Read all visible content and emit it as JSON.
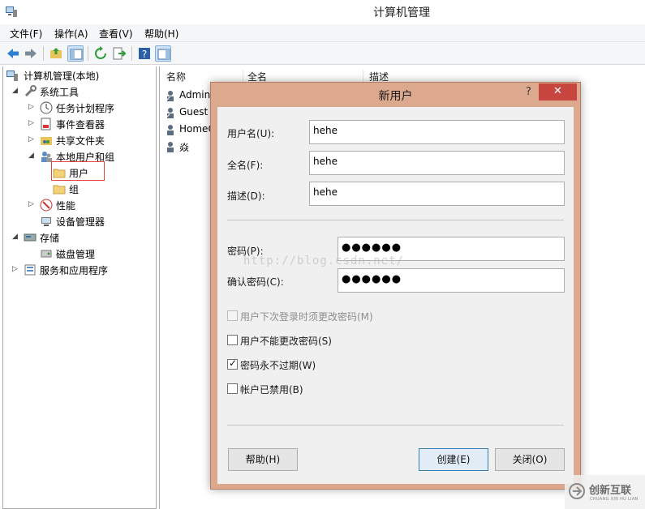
{
  "window": {
    "title": "计算机管理"
  },
  "menu": [
    "文件(F)",
    "操作(A)",
    "查看(V)",
    "帮助(H)"
  ],
  "tree": [
    {
      "label": "计算机管理(本地)",
      "icon": "computer-management-icon",
      "arrow": ""
    },
    {
      "label": "系统工具",
      "icon": "tools-icon",
      "arrow": "◢"
    },
    {
      "label": "任务计划程序",
      "icon": "clock-icon",
      "arrow": "▷"
    },
    {
      "label": "事件查看器",
      "icon": "event-viewer-icon",
      "arrow": "▷"
    },
    {
      "label": "共享文件夹",
      "icon": "shared-folder-icon",
      "arrow": "▷"
    },
    {
      "label": "本地用户和组",
      "icon": "users-groups-icon",
      "arrow": "◢"
    },
    {
      "label": "用户",
      "icon": "folder-icon",
      "arrow": ""
    },
    {
      "label": "组",
      "icon": "folder-icon",
      "arrow": ""
    },
    {
      "label": "性能",
      "icon": "performance-icon",
      "arrow": "▷"
    },
    {
      "label": "设备管理器",
      "icon": "device-manager-icon",
      "arrow": ""
    },
    {
      "label": "存储",
      "icon": "storage-icon",
      "arrow": "◢"
    },
    {
      "label": "磁盘管理",
      "icon": "disk-icon",
      "arrow": ""
    },
    {
      "label": "服务和应用程序",
      "icon": "services-icon",
      "arrow": "▷"
    }
  ],
  "list": {
    "columns": [
      "名称",
      "全名",
      "描述"
    ],
    "rows": [
      "Admini",
      "Guest",
      "HomeG",
      "焱"
    ]
  },
  "dialog": {
    "title": "新用户",
    "help_glyph": "?",
    "close_glyph": "✕",
    "username_label": "用户名(U):",
    "username_value": "hehe",
    "fullname_label": "全名(F):",
    "fullname_value": "hehe",
    "description_label": "描述(D):",
    "description_value": "hehe",
    "password_label": "密码(P):",
    "password_value": "●●●●●●",
    "confirm_label": "确认密码(C):",
    "confirm_value": "●●●●●●",
    "checkboxes": [
      {
        "label": "用户下次登录时须更改密码(M)",
        "checked": false,
        "disabled": true
      },
      {
        "label": "用户不能更改密码(S)",
        "checked": false,
        "disabled": false
      },
      {
        "label": "密码永不过期(W)",
        "checked": true,
        "disabled": false
      },
      {
        "label": "帐户已禁用(B)",
        "checked": false,
        "disabled": false
      }
    ],
    "help_button": "帮助(H)",
    "create_button": "创建(E)",
    "close_button": "关闭(O)"
  },
  "watermark": "http://blog.csdn.net/",
  "brand": {
    "name": "创新互联",
    "sub": "CHUANG XIN HU LIAN"
  }
}
